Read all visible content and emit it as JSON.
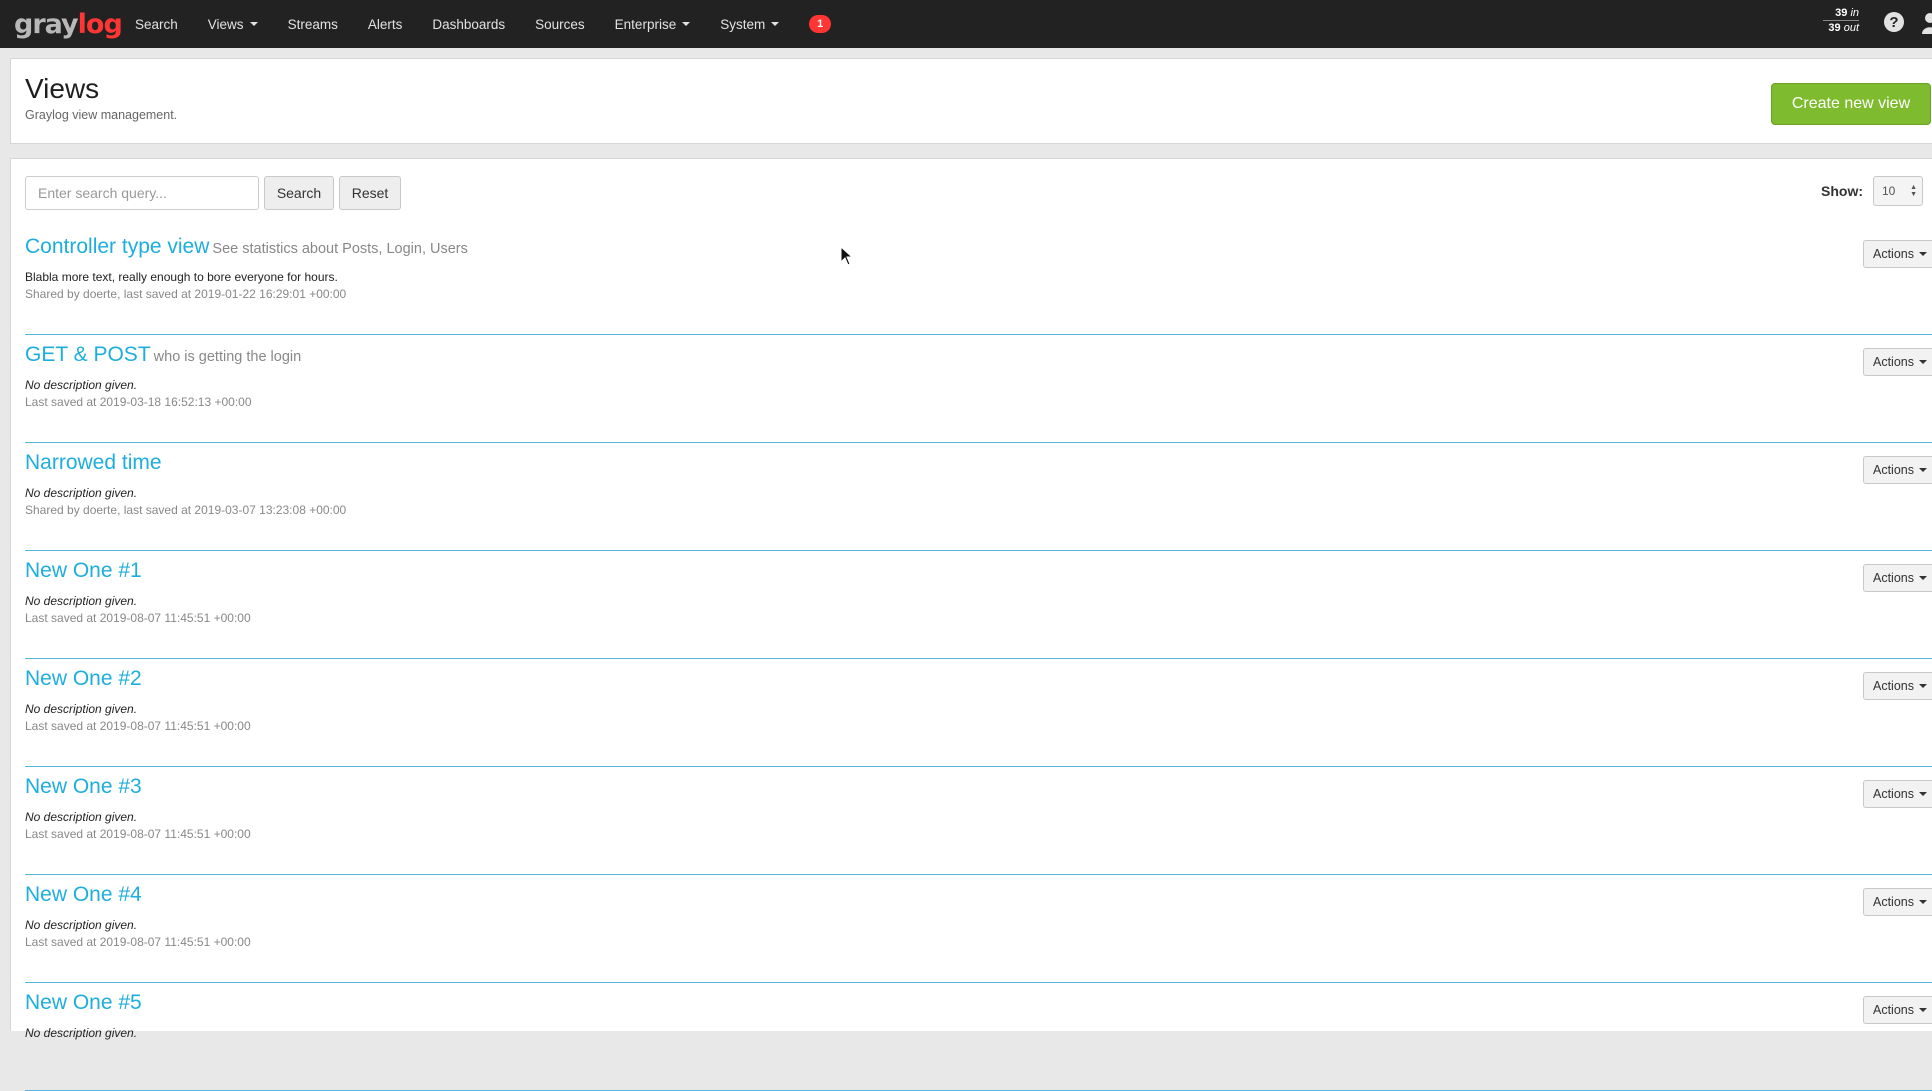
{
  "navbar": {
    "logo_gray": "gray",
    "logo_red": "log",
    "items": [
      {
        "label": "Search",
        "dropdown": false
      },
      {
        "label": "Views",
        "dropdown": true
      },
      {
        "label": "Streams",
        "dropdown": false
      },
      {
        "label": "Alerts",
        "dropdown": false
      },
      {
        "label": "Dashboards",
        "dropdown": false
      },
      {
        "label": "Sources",
        "dropdown": false
      },
      {
        "label": "Enterprise",
        "dropdown": true
      },
      {
        "label": "System",
        "dropdown": true
      }
    ],
    "notification_count": "1",
    "throughput": {
      "in_value": "39",
      "in_unit": "in",
      "out_value": "39",
      "out_unit": "out"
    },
    "help_icon": "question-circle-icon",
    "user_icon": "user-icon"
  },
  "header": {
    "title": "Views",
    "subtitle": "Graylog view management.",
    "create_label": "Create new view"
  },
  "toolbar": {
    "search_placeholder": "Enter search query...",
    "search_label": "Search",
    "reset_label": "Reset",
    "show_label": "Show:",
    "show_value": "10"
  },
  "views": [
    {
      "title": "Controller type view",
      "summary": "See statistics about Posts, Login, Users",
      "description": "Blabla more text, really enough to bore everyone for hours.",
      "meta": "Shared by doerte, last saved at 2019-01-22 16:29:01 +00:00",
      "actions": "Actions"
    },
    {
      "title": "GET & POST",
      "summary": "who is getting the login",
      "description": "No description given.",
      "meta": "Last saved at 2019-03-18 16:52:13 +00:00",
      "actions": "Actions"
    },
    {
      "title": "Narrowed time",
      "summary": "",
      "description": "No description given.",
      "meta": "Shared by doerte, last saved at 2019-03-07 13:23:08 +00:00",
      "actions": "Actions"
    },
    {
      "title": "New One #1",
      "summary": "",
      "description": "No description given.",
      "meta": "Last saved at 2019-08-07 11:45:51 +00:00",
      "actions": "Actions"
    },
    {
      "title": "New One #2",
      "summary": "",
      "description": "No description given.",
      "meta": "Last saved at 2019-08-07 11:45:51 +00:00",
      "actions": "Actions"
    },
    {
      "title": "New One #3",
      "summary": "",
      "description": "No description given.",
      "meta": "Last saved at 2019-08-07 11:45:51 +00:00",
      "actions": "Actions"
    },
    {
      "title": "New One #4",
      "summary": "",
      "description": "No description given.",
      "meta": "Last saved at 2019-08-07 11:45:51 +00:00",
      "actions": "Actions"
    },
    {
      "title": "New One #5",
      "summary": "",
      "description": "No description given.",
      "meta": "",
      "actions": "Actions"
    }
  ]
}
